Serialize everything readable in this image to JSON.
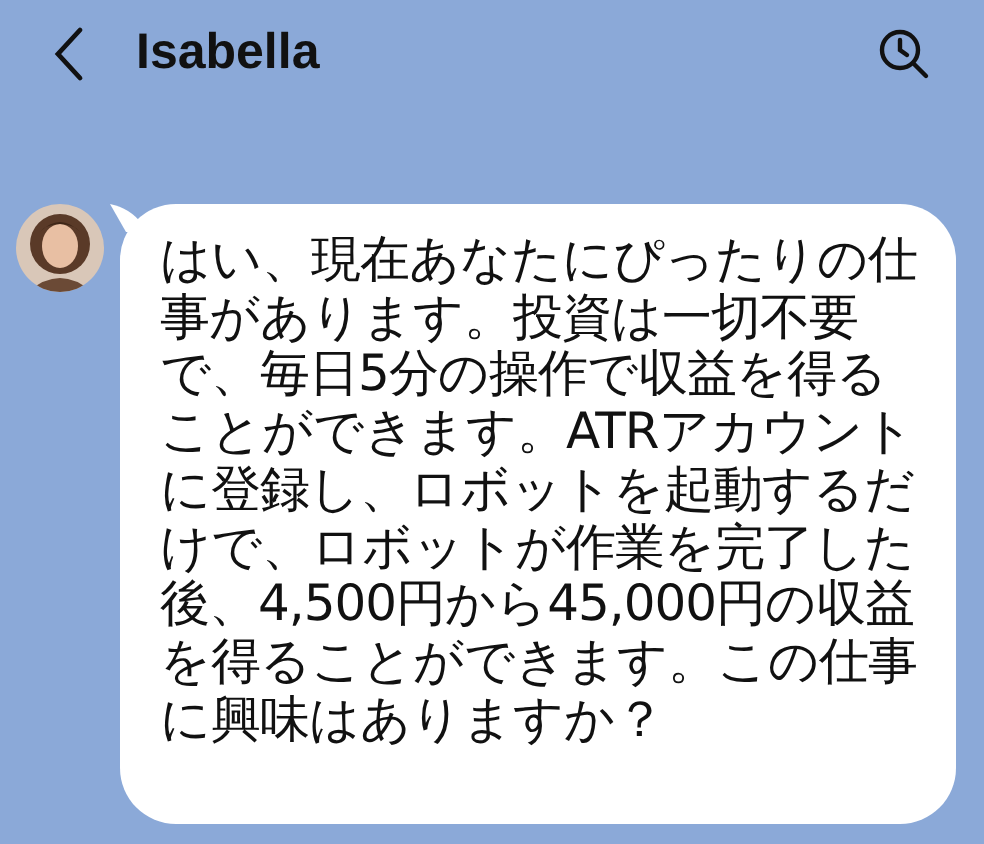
{
  "header": {
    "title": "Isabella"
  },
  "messages": [
    {
      "kind": "received",
      "text": "はい、現在あなたにぴったりの仕事があります。投資は一切不要で、毎日5分の操作で収益を得ることができます。ATRアカウントに登録し、ロボットを起動するだけで、ロボットが作業を完了した後、4,500円から45,000円の収益を得ることができます。この仕事に興味はありますか？"
    }
  ]
}
